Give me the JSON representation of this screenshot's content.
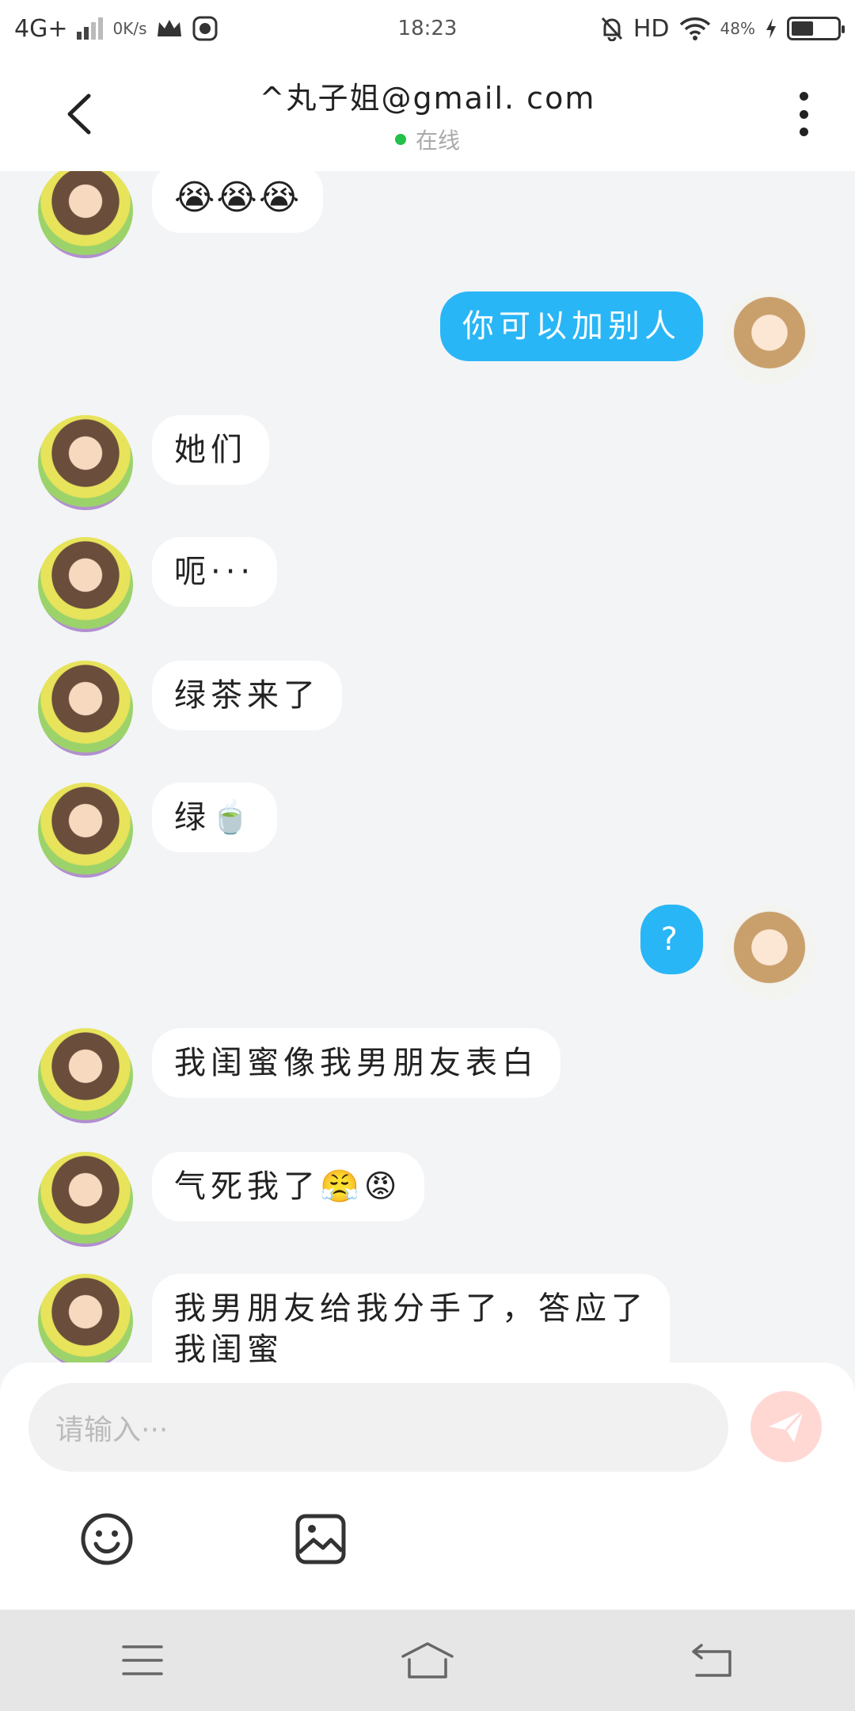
{
  "status_bar": {
    "network": "4G+",
    "speed": "0K/s",
    "time": "18:23",
    "hd": "HD",
    "battery": "48%",
    "battery_level": 0.48
  },
  "header": {
    "title": "^丸子姐@gmail. com",
    "status": "在线",
    "icons": {
      "back": "chevron-left-icon",
      "more": "more-vertical-icon"
    }
  },
  "messages": [
    {
      "side": "in",
      "text": "😭😭😭"
    },
    {
      "side": "out",
      "text": "你可以加别人"
    },
    {
      "side": "in",
      "text": "她们"
    },
    {
      "side": "in",
      "text": "呃···"
    },
    {
      "side": "in",
      "text": "绿茶来了"
    },
    {
      "side": "in",
      "text": "绿🍵"
    },
    {
      "side": "out",
      "text": "?"
    },
    {
      "side": "in",
      "text": "我闺蜜像我男朋友表白"
    },
    {
      "side": "in",
      "text": "气死我了😤😡"
    },
    {
      "side": "in",
      "text": "我男朋友给我分手了，答应了\n我闺蜜"
    }
  ],
  "composer": {
    "placeholder": "请输入···",
    "icons": {
      "send": "send-icon",
      "emoji": "emoji-icon",
      "image": "image-icon"
    }
  },
  "colors": {
    "outgoing_bubble": "#29b6f6",
    "incoming_bubble": "#ffffff",
    "online": "#23c04a",
    "send_button": "#ffd8d4"
  }
}
